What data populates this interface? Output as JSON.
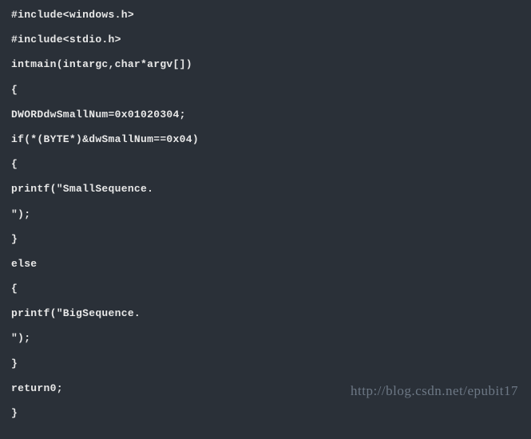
{
  "code": {
    "lines": [
      "#include<windows.h>",
      "#include<stdio.h>",
      "intmain(intargc,char*argv[])",
      "{",
      "DWORDdwSmallNum=0x01020304;",
      "if(*(BYTE*)&dwSmallNum==0x04)",
      "{",
      "printf(\"SmallSequence.",
      "\");",
      "}",
      "else",
      "{",
      "printf(\"BigSequence.",
      "\");",
      "}",
      "return0;",
      "}"
    ]
  },
  "watermark": "http://blog.csdn.net/epubit17"
}
